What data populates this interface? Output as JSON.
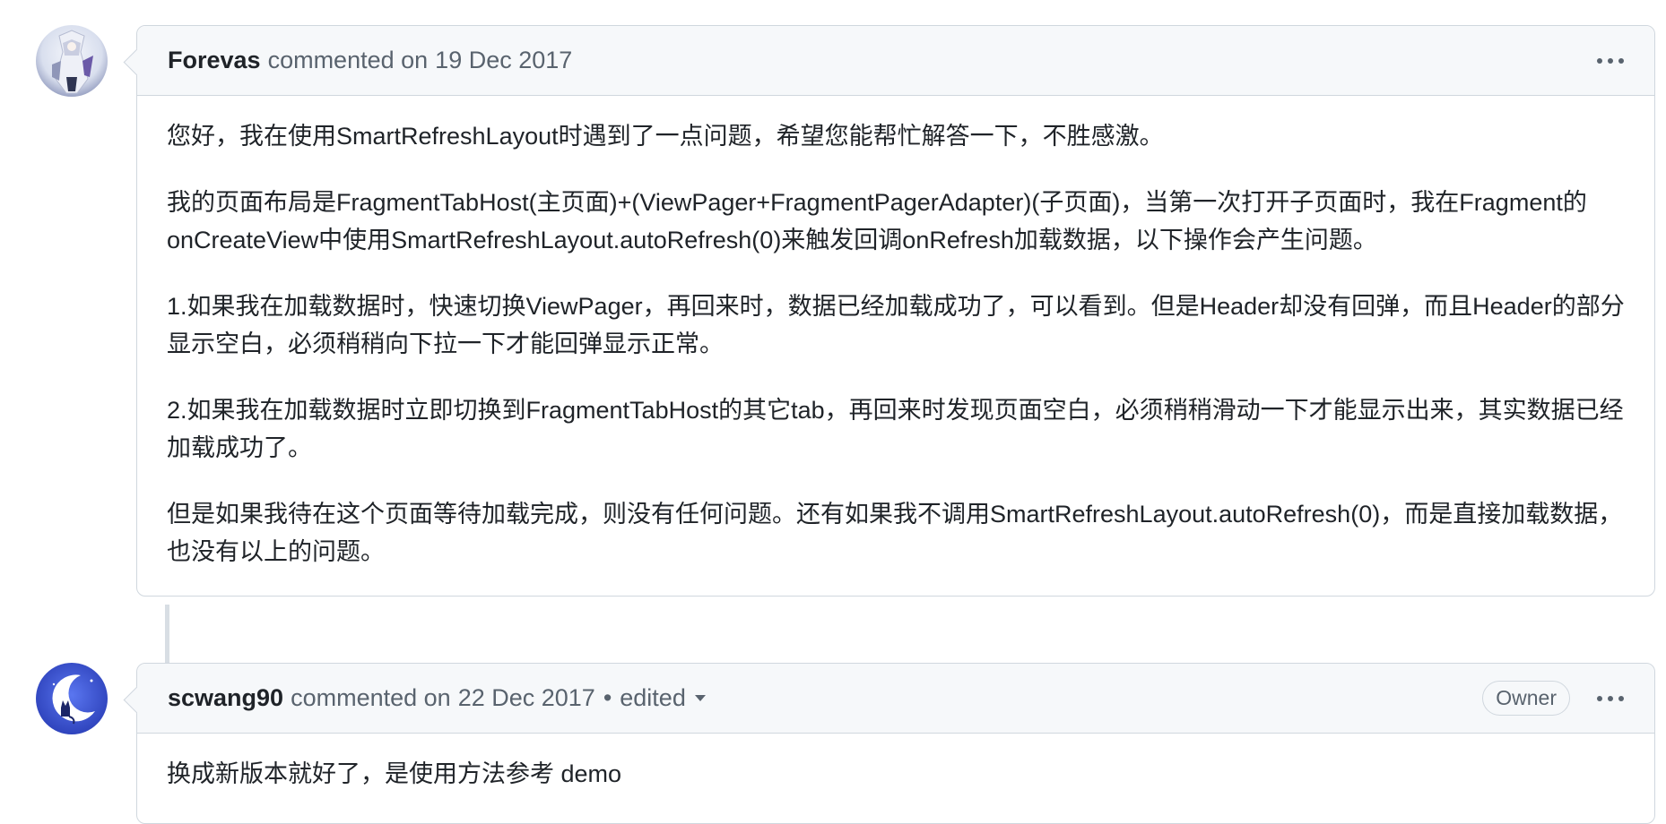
{
  "comments": [
    {
      "author": "Forevas",
      "action": "commented on",
      "date": "19 Dec 2017",
      "paragraphs": [
        "您好，我在使用SmartRefreshLayout时遇到了一点问题，希望您能帮忙解答一下，不胜感激。",
        "我的页面布局是FragmentTabHost(主页面)+(ViewPager+FragmentPagerAdapter)(子页面)，当第一次打开子页面时，我在Fragment的onCreateView中使用SmartRefreshLayout.autoRefresh(0)来触发回调onRefresh加载数据，以下操作会产生问题。",
        "1.如果我在加载数据时，快速切换ViewPager，再回来时，数据已经加载成功了，可以看到。但是Header却没有回弹，而且Header的部分显示空白，必须稍稍向下拉一下才能回弹显示正常。",
        "2.如果我在加载数据时立即切换到FragmentTabHost的其它tab，再回来时发现页面空白，必须稍稍滑动一下才能显示出来，其实数据已经加载成功了。",
        "但是如果我待在这个页面等待加载完成，则没有任何问题。还有如果我不调用SmartRefreshLayout.autoRefresh(0)，而是直接加载数据，也没有以上的问题。"
      ]
    },
    {
      "author": "scwang90",
      "action": "commented on",
      "date": "22 Dec 2017",
      "separator": "•",
      "edited": "edited",
      "badge": "Owner",
      "paragraphs": [
        "换成新版本就好了，是使用方法参考 demo"
      ]
    }
  ],
  "icons": {
    "menu": "kebab-horizontal-icon",
    "edited_dropdown": "caret-down-icon"
  },
  "colors": {
    "header_bg": "#f6f8fa",
    "border": "#d0d7de",
    "muted_text": "#59636e",
    "text": "#1f2328",
    "avatar2_bg": "#3b53d6"
  }
}
